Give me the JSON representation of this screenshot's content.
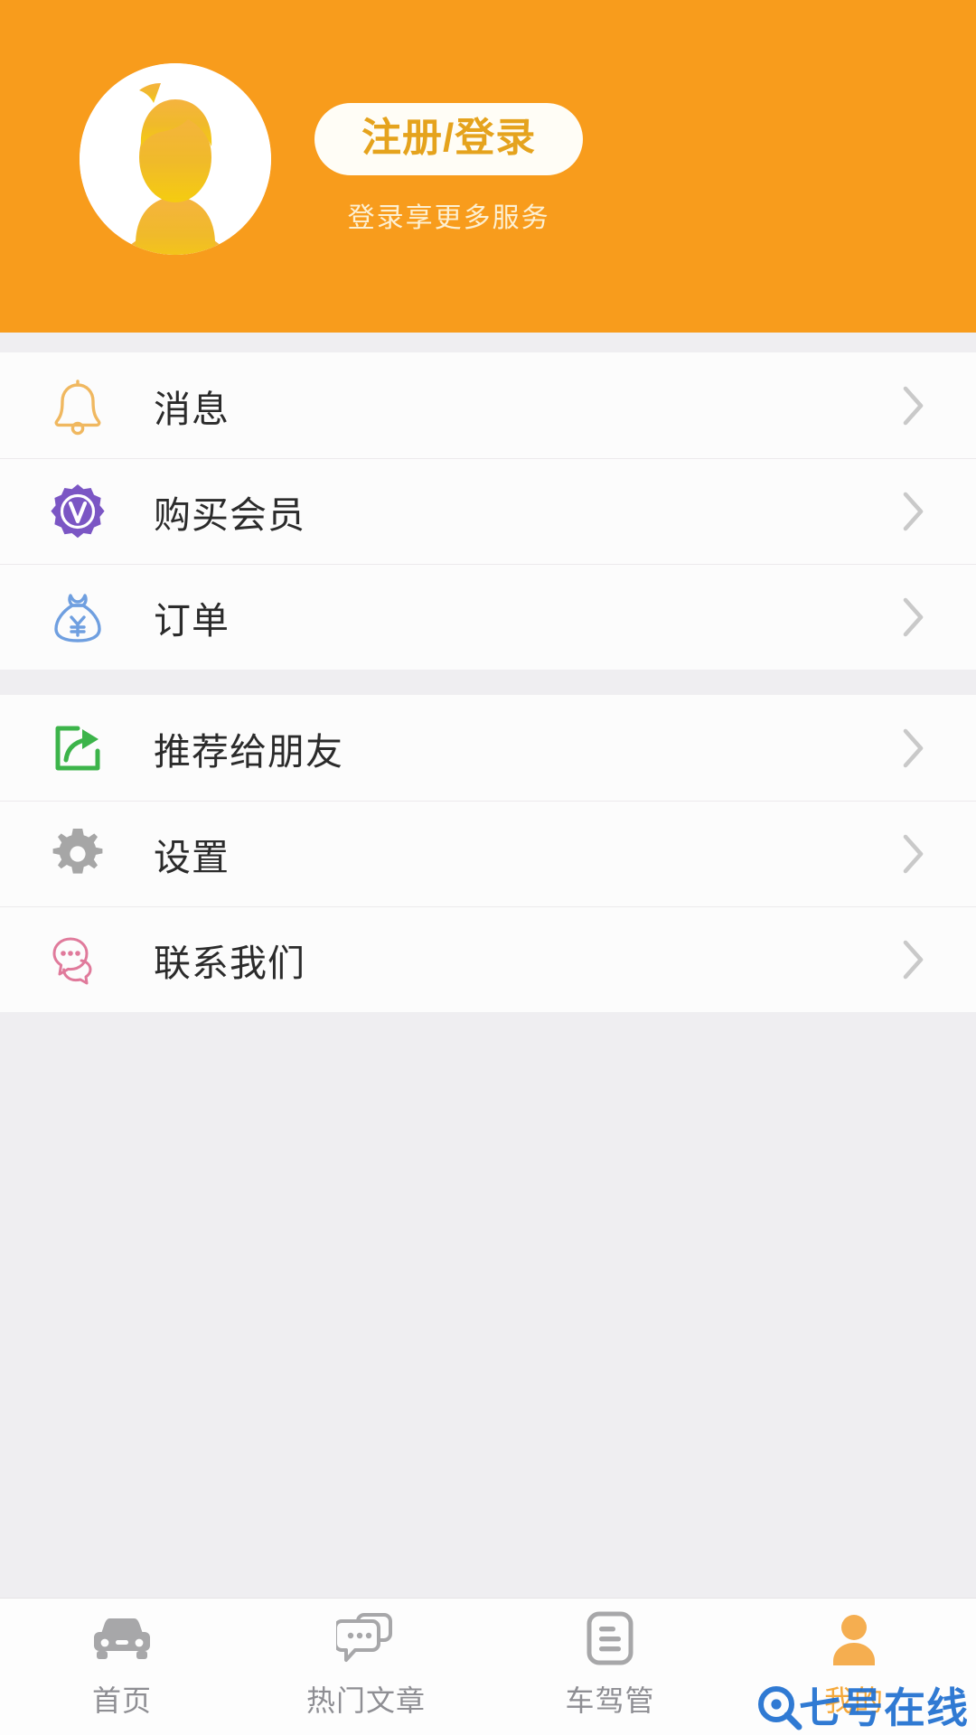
{
  "header": {
    "avatar_icon": "default-user-avatar",
    "login_button": "注册/登录",
    "subtitle": "登录享更多服务",
    "bg_color": "#f89c1c",
    "button_text_color": "#e5a31d"
  },
  "menu_groups": [
    {
      "items": [
        {
          "icon": "bell-icon",
          "label": "消息",
          "icon_color": "#f0b860",
          "chevron": "›"
        },
        {
          "icon": "vip-badge-icon",
          "label": "购买会员",
          "icon_color": "#7b56c4",
          "chevron": "›"
        },
        {
          "icon": "money-bag-icon",
          "label": "订单",
          "icon_color": "#6f9fe0",
          "chevron": "›"
        }
      ]
    },
    {
      "items": [
        {
          "icon": "share-icon",
          "label": "推荐给朋友",
          "icon_color": "#3cb44a",
          "chevron": "›"
        },
        {
          "icon": "gear-icon",
          "label": "设置",
          "icon_color": "#a6a6a6",
          "chevron": "›"
        },
        {
          "icon": "chat-bubbles-icon",
          "label": "联系我们",
          "icon_color": "#e07a9b",
          "chevron": "›"
        }
      ]
    }
  ],
  "tabbar": {
    "active_color": "#f5a93c",
    "inactive_color": "#8e8e93",
    "tabs": [
      {
        "icon": "car-icon",
        "label": "首页",
        "active": false
      },
      {
        "icon": "comment-icon",
        "label": "热门文章",
        "active": false
      },
      {
        "icon": "document-icon",
        "label": "车驾管",
        "active": false
      },
      {
        "icon": "person-icon",
        "label": "我的",
        "active": true
      }
    ]
  },
  "watermark": {
    "logo_icon": "magnifier-logo-icon",
    "text": "七号在线",
    "color": "#1f6fd0"
  }
}
